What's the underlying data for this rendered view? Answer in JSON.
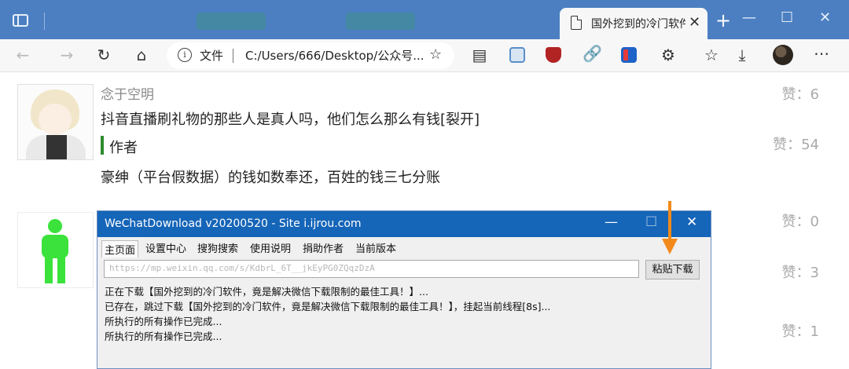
{
  "browser": {
    "active_tab_title": "国外挖到的冷门软件",
    "address": {
      "kind": "文件",
      "url": "C:/Users/666/Desktop/公众号..."
    }
  },
  "comments": [
    {
      "nickname": "念于空明",
      "text": "抖音直播刷礼物的那些人是真人吗，他们怎么那么有钱[裂开]",
      "likes_label": "赞：6"
    },
    {
      "author_tag": "作者",
      "text": "豪绅（平台假数据）的钱如数奉还，百姓的钱三七分账",
      "likes_label": "赞：54"
    }
  ],
  "other_likes": [
    "赞：0",
    "赞：3",
    "赞：1"
  ],
  "dialog": {
    "title": "WeChatDownload v20200520 - Site i.ijrou.com",
    "menu": [
      "主页面",
      "设置中心",
      "搜狗搜索",
      "使用说明",
      "捐助作者",
      "当前版本"
    ],
    "url_value": "https://mp.weixin.qq.com/s/KdbrL_6T__jkEyPG0ZQqzDzA",
    "paste_button": "粘贴下载",
    "log_lines": [
      "正在下载【国外挖到的冷门软件，竟是解决微信下载限制的最佳工具！】...",
      "已存在，跳过下载【国外挖到的冷门软件，竟是解决微信下载限制的最佳工具！】，挂起当前线程[8s]...",
      "所执行的所有操作已完成...",
      "所执行的所有操作已完成..."
    ]
  },
  "colors": {
    "tab_strip": "#4b7fc2",
    "dialog_title": "#1565b8",
    "arrow": "#f28a1b",
    "author_mark": "#2e8b2e"
  }
}
